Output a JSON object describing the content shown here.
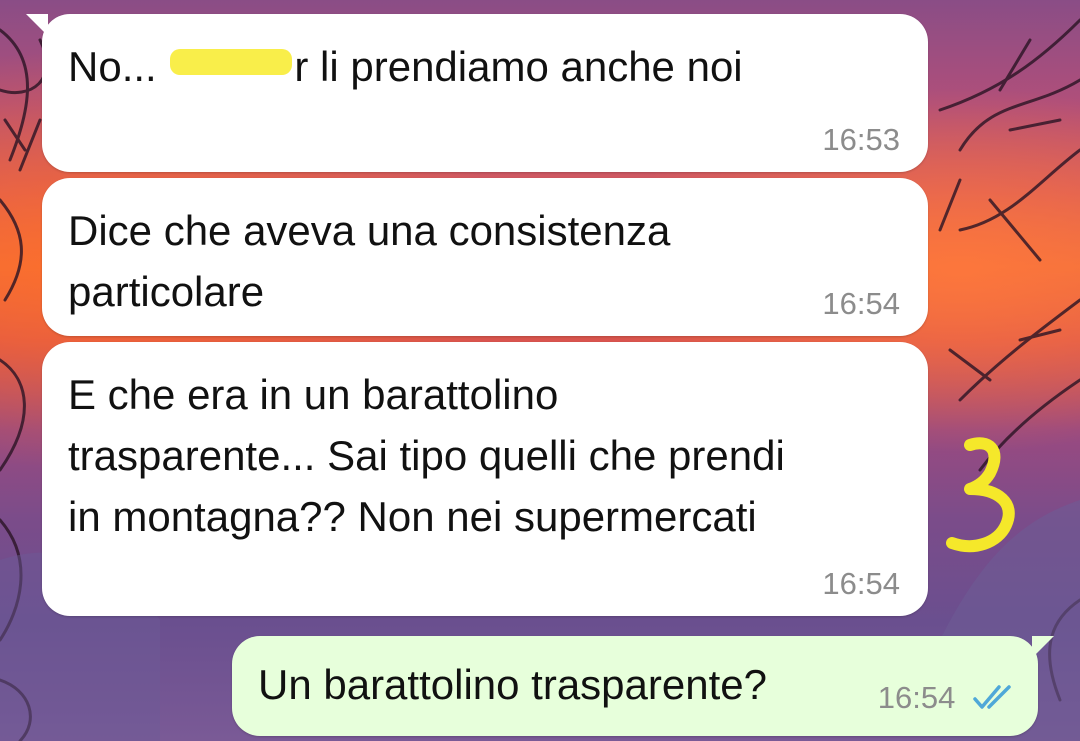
{
  "messages": [
    {
      "direction": "incoming",
      "text_before": "No...",
      "text_after": "r li prendiamo anche noi",
      "has_redaction": true,
      "time": "16:53"
    },
    {
      "direction": "incoming",
      "text": "Dice che aveva una consistenza\nparticolare",
      "time": "16:54"
    },
    {
      "direction": "incoming",
      "text": "E che era in un barattolino\ntrasparente... Sai tipo quelli che prendi\nin montagna?? Non nei supermercati",
      "time": "16:54"
    },
    {
      "direction": "outgoing",
      "text": "Un barattolino trasparente?",
      "time": "16:54",
      "status": "read"
    }
  ],
  "annotation": {
    "text": "3",
    "color": "#f5e82a"
  },
  "colors": {
    "incoming_bubble": "#ffffff",
    "outgoing_bubble": "#e7ffdb",
    "read_ticks": "#4fa8d8",
    "redaction": "#f9ee4a",
    "timestamp": "#8c8c8c"
  },
  "icons": {
    "status_icon": "double-check-icon"
  }
}
